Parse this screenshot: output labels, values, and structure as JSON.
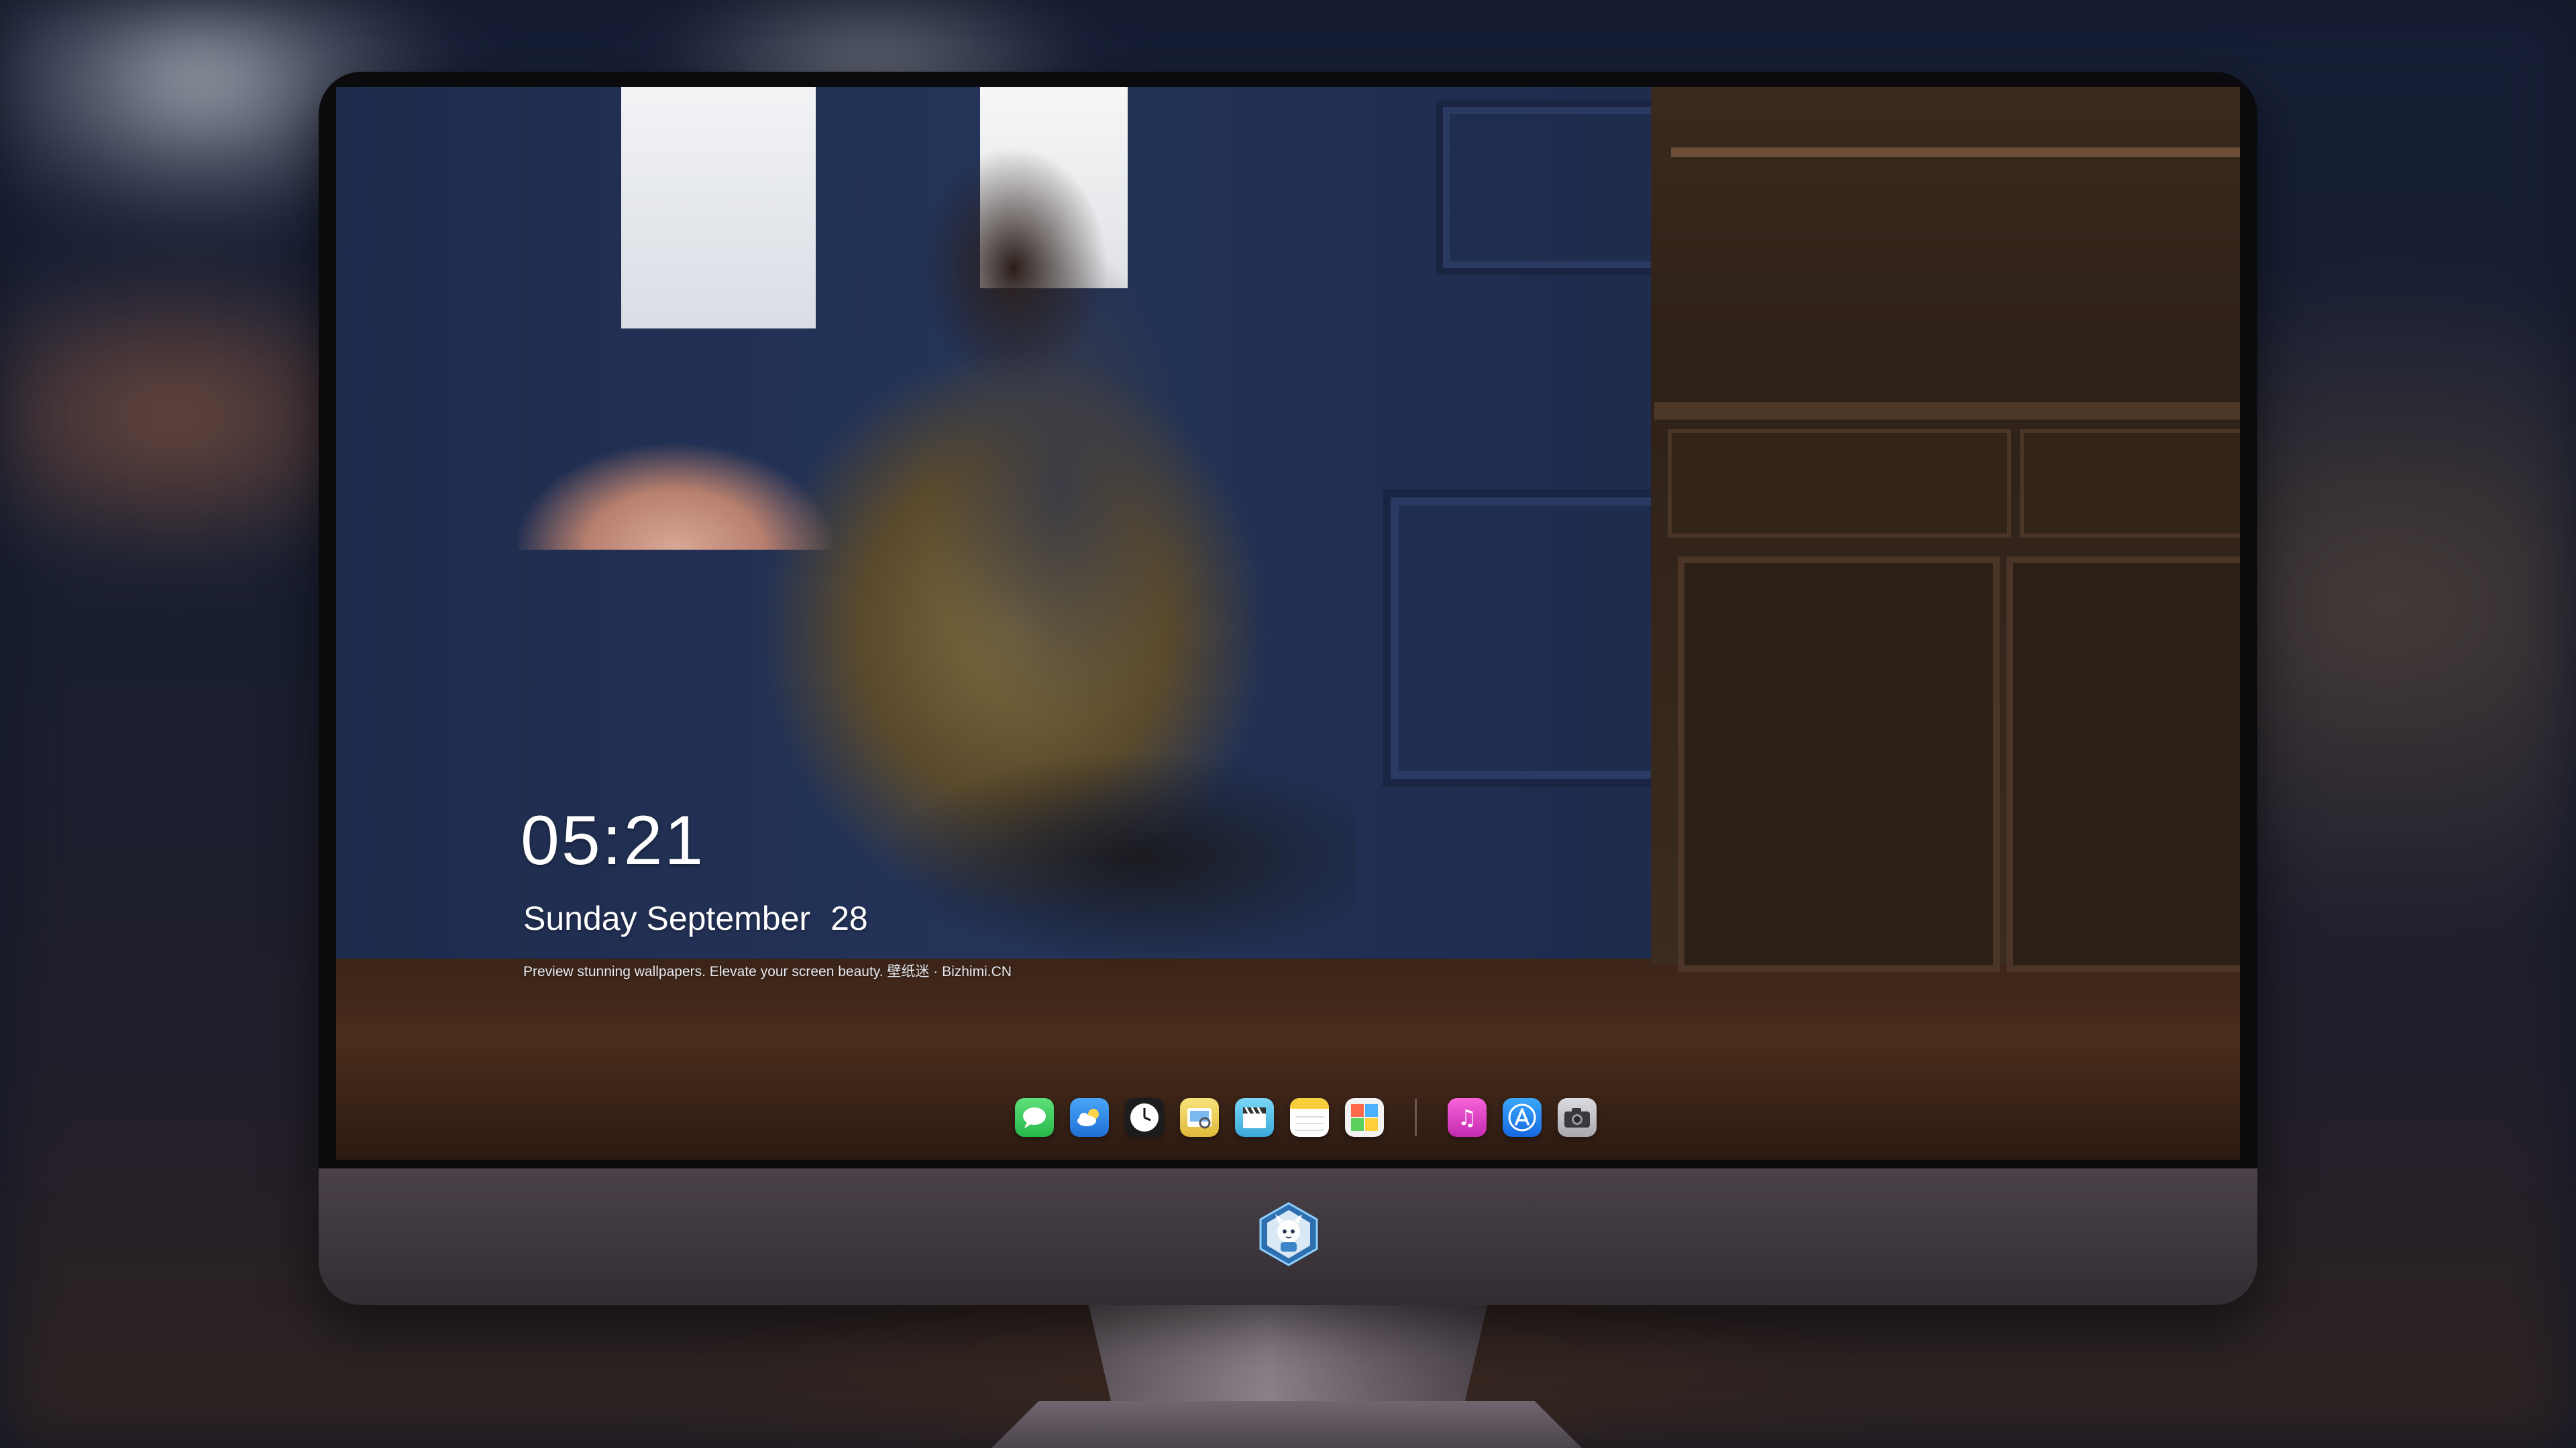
{
  "lock_screen": {
    "time": "05:21",
    "weekday_month": "Sunday September",
    "day": "28",
    "caption": "Preview stunning wallpapers. Elevate your screen beauty. 壁纸迷 · Bizhimi.CN"
  },
  "dock": {
    "left_apps": [
      {
        "name": "messages-icon",
        "color": "#34c759"
      },
      {
        "name": "weather-icon",
        "color": "#2f8cf0"
      },
      {
        "name": "clock-icon",
        "color": "#1c1c1e"
      },
      {
        "name": "preview-icon",
        "color": "#f2d24a"
      },
      {
        "name": "video-clapper-icon",
        "color": "#59c8f0"
      },
      {
        "name": "notes-icon",
        "color": "#f7d046"
      },
      {
        "name": "photo-collage-icon",
        "color": "#f0f0f0"
      }
    ],
    "right_apps": [
      {
        "name": "music-icon",
        "color": "#e83ec6"
      },
      {
        "name": "app-store-icon",
        "color": "#1e8cf5"
      },
      {
        "name": "camera-icon",
        "color": "#c9c9cc"
      }
    ]
  },
  "colors": {
    "monitor_bezel": "#0b0b0d",
    "monitor_chin": "#3c353c",
    "wall_blue": "#243459"
  },
  "chin_logo": "mascot-logo"
}
